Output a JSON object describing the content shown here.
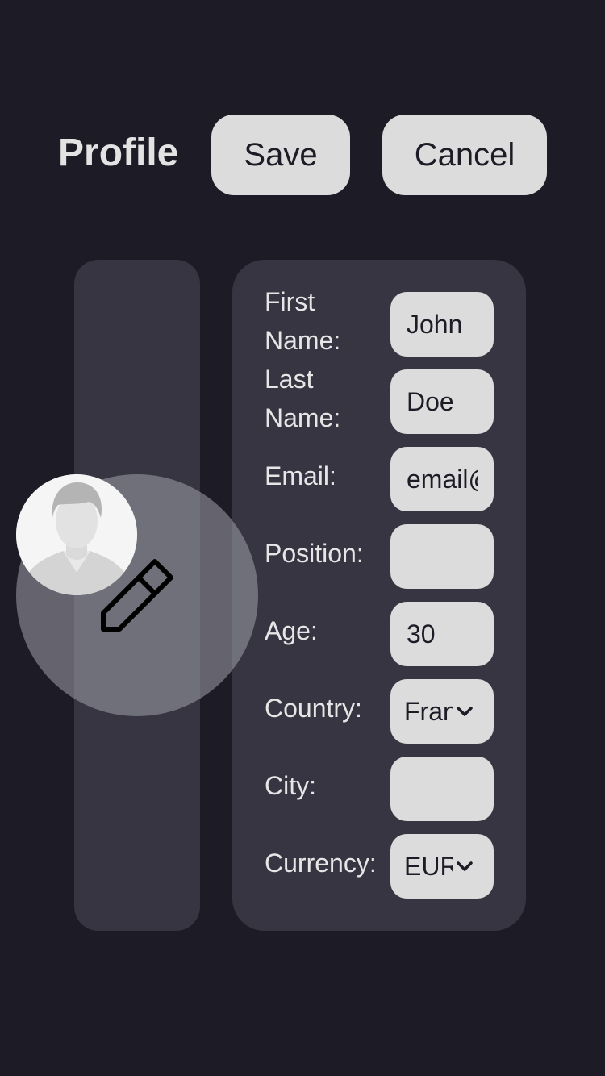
{
  "header": {
    "title": "Profile",
    "save_label": "Save",
    "cancel_label": "Cancel"
  },
  "form": {
    "first_name": {
      "label_line1": "First",
      "label_line2": "Name:",
      "value": "John"
    },
    "last_name": {
      "label_line1": "Last",
      "label_line2": "Name:",
      "value": "Doe"
    },
    "email": {
      "label": "Email:",
      "value": "email@"
    },
    "position": {
      "label": "Position:",
      "value": ""
    },
    "age": {
      "label": "Age:",
      "value": "30"
    },
    "country": {
      "label": "Country:",
      "value": "France"
    },
    "city": {
      "label": "City:",
      "value": ""
    },
    "currency": {
      "label": "Currency:",
      "value": "EUR"
    }
  },
  "icons": {
    "avatar": "user-avatar-placeholder",
    "edit": "pencil-icon",
    "dropdown": "chevron-down-icon"
  },
  "colors": {
    "background": "#1d1c26",
    "panel": "#363541",
    "control": "#dcdcdc",
    "text_light": "#e6e6e6",
    "text_dark": "#1d1c26"
  }
}
